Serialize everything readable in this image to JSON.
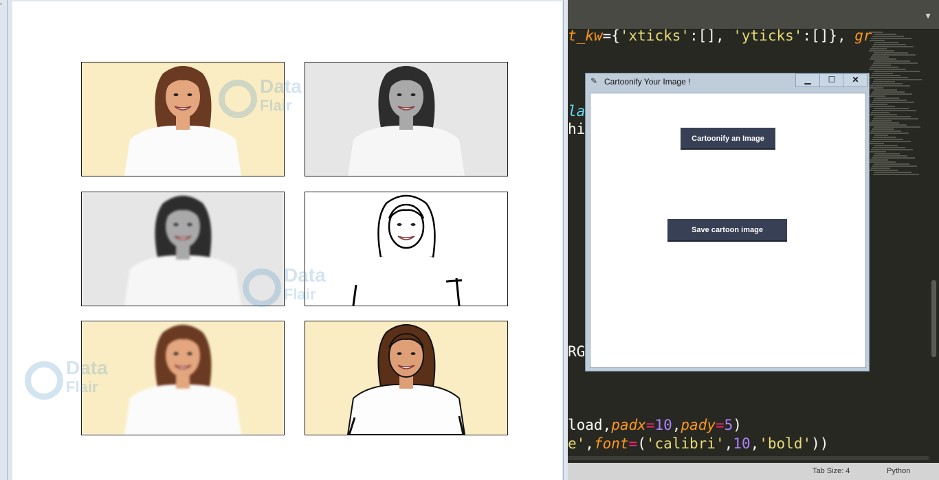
{
  "editor": {
    "code_lines": [
      {
        "segments": [
          [
            "t_kw",
            "c-arg"
          ],
          [
            "={",
            "plain"
          ],
          [
            "'xticks'",
            "c-str"
          ],
          [
            ":[], ",
            "plain"
          ],
          [
            "'yticks'",
            "c-str"
          ],
          [
            ":[]}, ",
            "plain"
          ],
          [
            "gr",
            "c-arg"
          ]
        ]
      },
      {
        "segments": [
          [
            "la",
            "c-fn"
          ]
        ]
      },
      {
        "segments": [
          [
            "hi",
            "plain"
          ]
        ]
      },
      {
        "segments": [
          [
            "RG",
            "plain"
          ]
        ]
      },
      {
        "segments": [
          [
            "load,",
            "plain"
          ],
          [
            "padx",
            "c-arg"
          ],
          [
            "=",
            "c-kw"
          ],
          [
            "10",
            "c-num"
          ],
          [
            ",",
            "plain"
          ],
          [
            "pady",
            "c-arg"
          ],
          [
            "=",
            "c-kw"
          ],
          [
            "5",
            "c-num"
          ],
          [
            ")",
            "plain"
          ]
        ]
      },
      {
        "segments": [
          [
            "e'",
            "c-str"
          ],
          [
            ",",
            "plain"
          ],
          [
            "font",
            "c-arg"
          ],
          [
            "=",
            "c-kw"
          ],
          [
            "(",
            "plain"
          ],
          [
            "'calibri'",
            "c-str"
          ],
          [
            ",",
            "plain"
          ],
          [
            "10",
            "c-num"
          ],
          [
            ",",
            "plain"
          ],
          [
            "'bold'",
            "c-str"
          ],
          [
            "))",
            "plain"
          ]
        ]
      }
    ],
    "status": {
      "tab_size": "Tab Size: 4",
      "language": "Python"
    },
    "tab_dropdown_icon": "chevron-down-icon"
  },
  "figure": {
    "panels": [
      {
        "name": "original-image",
        "style": "color"
      },
      {
        "name": "grayscale-image",
        "style": "gray"
      },
      {
        "name": "blurred-grayscale-image",
        "style": "gray"
      },
      {
        "name": "edge-sketch-image",
        "style": "sketch"
      },
      {
        "name": "color-smoothed-image",
        "style": "color"
      },
      {
        "name": "cartoon-image",
        "style": "cartoon"
      }
    ],
    "watermark": {
      "line1": "Data",
      "line2": "Flair"
    }
  },
  "dialog": {
    "title": "Cartoonify Your Image !",
    "title_icon": "feather-icon",
    "controls": {
      "minimize": "▁",
      "maximize": "☐",
      "close": "✕"
    },
    "upload_button": "Cartoonify an Image",
    "save_button": "Save cartoon image"
  },
  "colors": {
    "editor_bg": "#272822",
    "button_bg": "#374055",
    "warm_bg": "#faedc4",
    "gray_bg": "#e6e6e6"
  }
}
